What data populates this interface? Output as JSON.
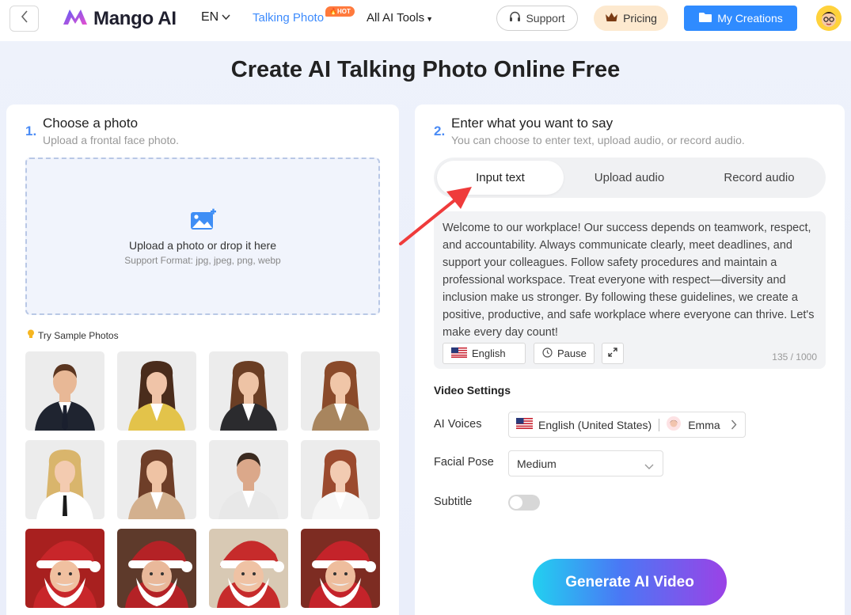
{
  "nav": {
    "logo_text": "Mango AI",
    "language": "EN",
    "talking_photo": "Talking Photo",
    "hot_badge": "HOT",
    "ai_tools": "All AI Tools",
    "support": "Support",
    "pricing": "Pricing",
    "my_creations": "My Creations"
  },
  "page_title": "Create AI Talking Photo Online Free",
  "step1": {
    "number": "1.",
    "title": "Choose a photo",
    "subtitle": "Upload a frontal face photo.",
    "upload_text": "Upload a photo or drop it here",
    "support_format": "Support Format: jpg, jpeg, png, webp",
    "samples_label": "Try Sample Photos"
  },
  "samples": [
    {
      "kind": "man",
      "skin": "#e8b896",
      "hair": "#5a3520",
      "suit": "#1f2430",
      "bg": "#ececec",
      "shirt": "#ffffff",
      "tie": "#1a1f2e"
    },
    {
      "kind": "woman",
      "skin": "#f0c4a8",
      "hair": "#4a2c1c",
      "suit": "#e3c34a",
      "bg": "#ececec",
      "shirt": "#ffffff",
      "tie": ""
    },
    {
      "kind": "woman",
      "skin": "#eec3a5",
      "hair": "#6b3e24",
      "suit": "#2b2b2e",
      "bg": "#ececec",
      "shirt": "#ffffff",
      "tie": ""
    },
    {
      "kind": "woman",
      "skin": "#f0c6a8",
      "hair": "#8a4a2a",
      "suit": "#a8855e",
      "bg": "#ececec",
      "shirt": "#ffffff",
      "tie": ""
    },
    {
      "kind": "woman",
      "skin": "#f3cbb0",
      "hair": "#d9b56c",
      "suit": "#ffffff",
      "bg": "#ececec",
      "shirt": "#ffffff",
      "tie": "#1a1a1a"
    },
    {
      "kind": "woman",
      "skin": "#efc3a4",
      "hair": "#6e3e28",
      "suit": "#d3b08e",
      "bg": "#ececec",
      "shirt": "#ffffff",
      "tie": ""
    },
    {
      "kind": "man",
      "skin": "#dba88a",
      "hair": "#3a2a20",
      "suit": "#e8e8e8",
      "bg": "#ececec",
      "shirt": "#ffffff",
      "tie": ""
    },
    {
      "kind": "woman",
      "skin": "#f2cbb2",
      "hair": "#9b4a2e",
      "suit": "#f6f6f6",
      "bg": "#ececec",
      "shirt": "#ffffff",
      "tie": ""
    },
    {
      "kind": "santa",
      "skin": "#f0c0a0",
      "hair": "#ffffff",
      "suit": "#c8262a",
      "bg": "#a8201f",
      "shirt": "#ffffff",
      "tie": ""
    },
    {
      "kind": "santa",
      "skin": "#e9b89a",
      "hair": "#ffffff",
      "suit": "#b42226",
      "bg": "#5e3a2b",
      "shirt": "#ffffff",
      "tie": ""
    },
    {
      "kind": "santa",
      "skin": "#efc2a4",
      "hair": "#ffffff",
      "suit": "#c62b2b",
      "bg": "#d8c9b4",
      "shirt": "#ffffff",
      "tie": ""
    },
    {
      "kind": "santa",
      "skin": "#eebd9d",
      "hair": "#ffffff",
      "suit": "#c4232a",
      "bg": "#7d2c22",
      "shirt": "#ffffff",
      "tie": ""
    }
  ],
  "step2": {
    "number": "2.",
    "title": "Enter what you want to say",
    "subtitle": "You can choose to enter text, upload audio, or record audio.",
    "tabs": [
      "Input text",
      "Upload audio",
      "Record audio"
    ],
    "active_tab": 0,
    "script": "Welcome to our workplace! Our success depends on teamwork, respect, and accountability. Always communicate clearly, meet deadlines, and support your colleagues. Follow safety procedures and maintain a professional workspace. Treat everyone with respect—diversity and inclusion make us stronger. By following these guidelines, we create a positive, productive, and safe workplace where everyone can thrive. Let's make every day count!",
    "language_btn": "English",
    "pause_btn": "Pause",
    "char_count": "135 / 1000"
  },
  "settings": {
    "title": "Video Settings",
    "ai_voices_label": "AI Voices",
    "voice_language": "English (United States)",
    "voice_name": "Emma",
    "facial_pose_label": "Facial Pose",
    "facial_pose_value": "Medium",
    "subtitle_label": "Subtitle",
    "subtitle_enabled": false
  },
  "generate_button": "Generate AI Video",
  "colors": {
    "accent": "#2f8bff",
    "link": "#3d8bfd",
    "hot": "#ff7a3d",
    "arrow": "#ef3b3b"
  }
}
